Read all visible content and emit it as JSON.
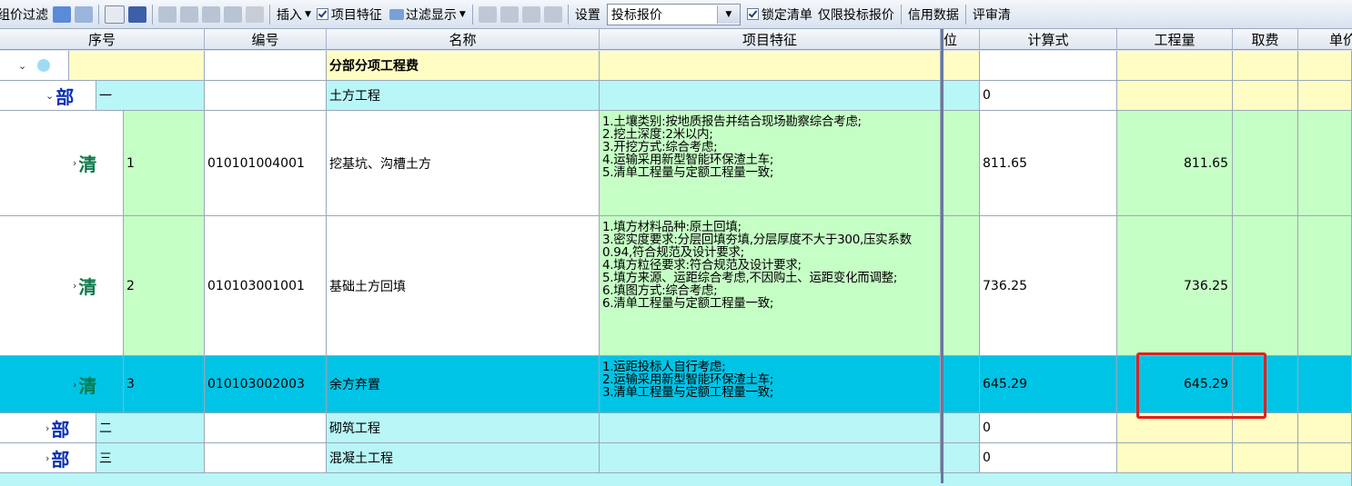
{
  "toolbar": {
    "group_filter": "组价过滤",
    "insert": "插入",
    "item_feature": "项目特征",
    "filter_display": "过滤显示",
    "settings": "设置",
    "mode_value": "投标报价",
    "lock_list": "锁定清单",
    "bid_only": "仅限投标报价",
    "credit_data": "信用数据",
    "review": "评审清"
  },
  "columns": [
    "序号",
    "编号",
    "名称",
    "项目特征",
    "单位",
    "计算式",
    "工程量",
    "取费",
    "单价"
  ],
  "rows": [
    {
      "tag": "",
      "seq": "",
      "code": "",
      "name": "分部分项工程费",
      "feature": "",
      "formula": "",
      "qty": ""
    },
    {
      "tag": "部",
      "seq": "一",
      "code": "",
      "name": "土方工程",
      "feature": "",
      "formula": "0",
      "qty": ""
    },
    {
      "tag": "清",
      "seq": "1",
      "code": "010101004001",
      "name": "挖基坑、沟槽土方",
      "feature": "1.土壤类别:按地质报告并结合现场勘察综合考虑;\n2.挖土深度:2米以内;\n3.开挖方式:综合考虑;\n4.运输采用新型智能环保渣土车;\n5.清单工程量与定额工程量一致;",
      "formula": "811.65",
      "qty": "811.65"
    },
    {
      "tag": "清",
      "seq": "2",
      "code": "010103001001",
      "name": "基础土方回填",
      "feature": "1.填方材料品种:原土回填;\n3.密实度要求:分层回填夯填,分层厚度不大于300,压实系数0.94,符合规范及设计要求;\n4.填方粒径要求:符合规范及设计要求;\n5.填方来源、运距综合考虑,不因购土、运距变化而调整;\n6.填图方式:综合考虑;\n6.清单工程量与定额工程量一致;",
      "formula": "736.25",
      "qty": "736.25"
    },
    {
      "tag": "清",
      "seq": "3",
      "code": "010103002003",
      "name": "余方弃置",
      "feature": "1.运距投标人自行考虑;\n2.运输采用新型智能环保渣土车;\n3.清单工程量与定额工程量一致;",
      "formula": "645.29",
      "qty": "645.29"
    },
    {
      "tag": "部",
      "seq": "二",
      "code": "",
      "name": "砌筑工程",
      "feature": "",
      "formula": "0",
      "qty": ""
    },
    {
      "tag": "部",
      "seq": "三",
      "code": "",
      "name": "混凝土工程",
      "feature": "",
      "formula": "0",
      "qty": ""
    }
  ],
  "colors": {
    "section": "#b8f6f8",
    "item": "#c6ffc6",
    "selected": "#00c4e6",
    "total_row": "#fffdc4",
    "qty_col": "#fffdc4",
    "highlight": "#e02020"
  }
}
